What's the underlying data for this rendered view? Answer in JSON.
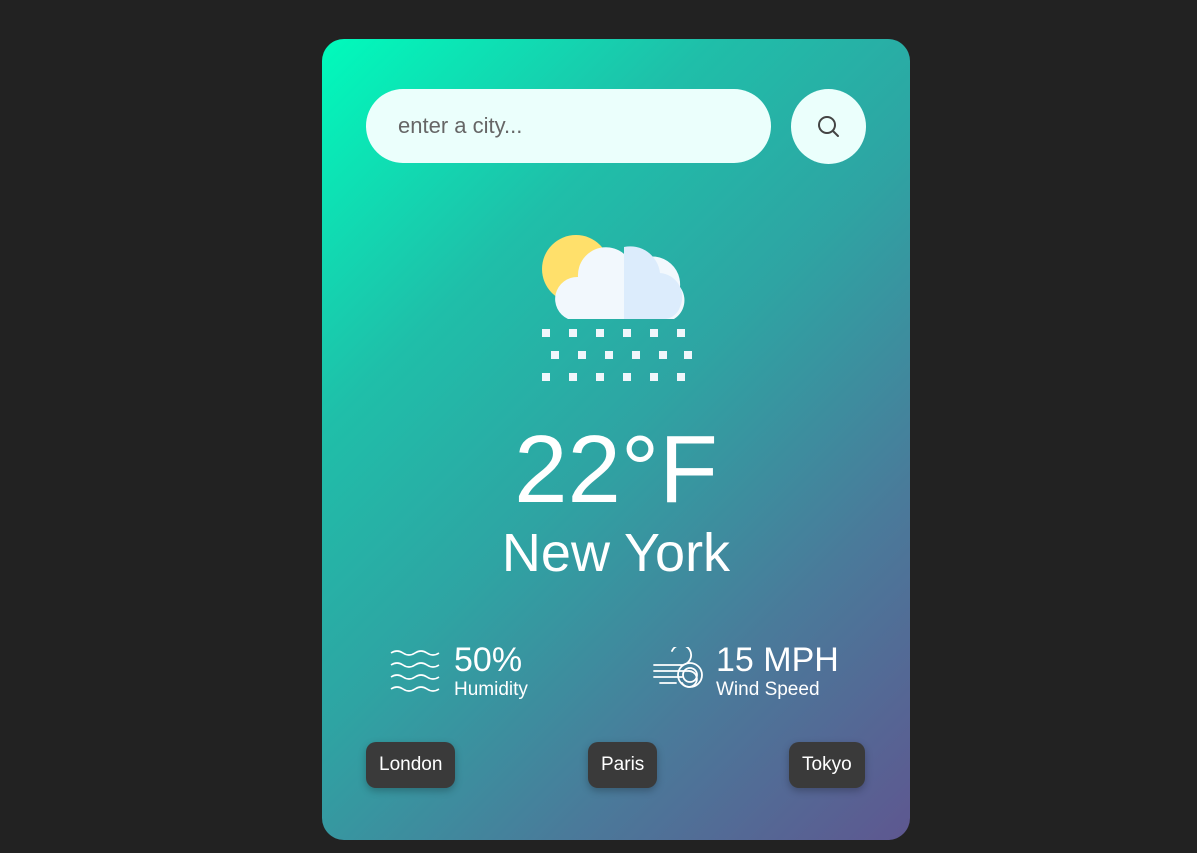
{
  "search": {
    "placeholder": "enter a city...",
    "button_icon": "search-icon"
  },
  "weather": {
    "icon": "snow-partly-cloudy-icon",
    "temperature": "22°F",
    "city": "New York"
  },
  "stats": {
    "humidity": {
      "icon": "humidity-waves-icon",
      "value": "50%",
      "label": "Humidity"
    },
    "wind": {
      "icon": "wind-icon",
      "value": "15 MPH",
      "label": "Wind Speed"
    }
  },
  "quick_cities": [
    "London",
    "Paris",
    "Tokyo"
  ],
  "colors": {
    "background": "#222222",
    "gradient_start": "#00fbbc",
    "gradient_end": "#5e5790",
    "input_bg": "#ebfffc",
    "city_button_bg": "#3a3a3a"
  }
}
